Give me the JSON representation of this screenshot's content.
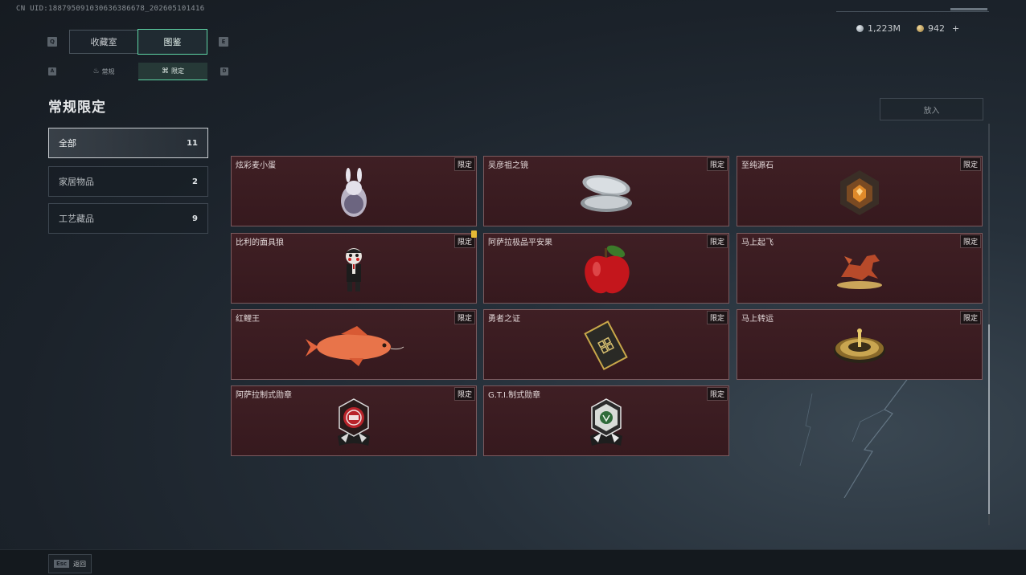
{
  "header": {
    "uid": "CN UID:188795091030636386678_202605101416",
    "currency_silver": "1,223M",
    "currency_gold": "942",
    "currency_add": "+"
  },
  "tabs": {
    "key_left": "Q",
    "key_right": "E",
    "collection": "收藏室",
    "catalog": "图鉴"
  },
  "subtabs": {
    "key_left": "A",
    "key_right": "D",
    "normal": "常规",
    "limited": "限定"
  },
  "section_title": "常规限定",
  "categories": [
    {
      "label": "全部",
      "count": "11"
    },
    {
      "label": "家居物品",
      "count": "2"
    },
    {
      "label": "工艺藏品",
      "count": "9"
    }
  ],
  "sort_button": "放入",
  "items": [
    {
      "name": "炫彩麦小蛋",
      "tag": "限定"
    },
    {
      "name": "吴彦祖之镜",
      "tag": "限定"
    },
    {
      "name": "至纯源石",
      "tag": "限定"
    },
    {
      "name": "比利的面具狼",
      "tag": "限定"
    },
    {
      "name": "阿萨拉极品平安果",
      "tag": "限定"
    },
    {
      "name": "马上起飞",
      "tag": "限定"
    },
    {
      "name": "红鲤王",
      "tag": "限定"
    },
    {
      "name": "勇者之证",
      "tag": "限定"
    },
    {
      "name": "马上转运",
      "tag": "限定"
    },
    {
      "name": "阿萨拉制式勋章",
      "tag": "限定"
    },
    {
      "name": "G.T.I.制式勋章",
      "tag": "限定"
    }
  ],
  "footer": {
    "esc_key": "Esc",
    "back_label": "返回"
  },
  "colors": {
    "accent": "#5fd6a6",
    "card_bg": "#3a1c21",
    "card_border": "#7a5a5e",
    "new_badge": "#e6b935"
  }
}
